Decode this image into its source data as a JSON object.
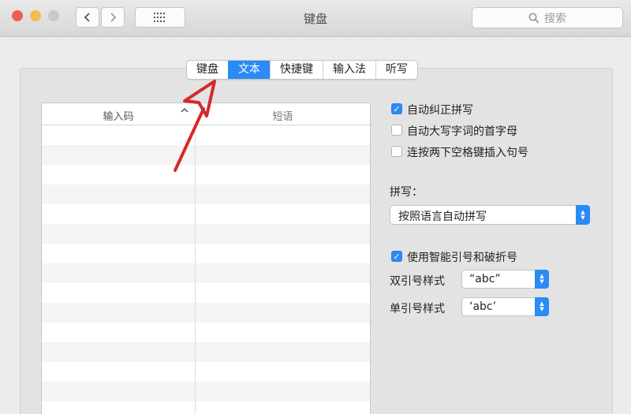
{
  "window": {
    "title": "键盘",
    "search_placeholder": "搜索",
    "traffic_lights": {
      "close": "#ee5d57",
      "minimize": "#f5bd4f",
      "zoom": "#c9c9c9"
    }
  },
  "toolbar": {
    "back_icon": "chevron-left-icon",
    "forward_icon": "chevron-right-icon",
    "grid_icon": "grid-icon",
    "search_icon": "magnifier-icon"
  },
  "tabs": [
    {
      "label": "键盘",
      "selected": false
    },
    {
      "label": "文本",
      "selected": true
    },
    {
      "label": "快捷键",
      "selected": false
    },
    {
      "label": "输入法",
      "selected": false
    },
    {
      "label": "听写",
      "selected": false
    }
  ],
  "table": {
    "col1_header": "输入码",
    "col2_header": "短语",
    "sort_icon": "sort-ascending-icon"
  },
  "options": {
    "autocorrect": {
      "label": "自动纠正拼写",
      "checked": true
    },
    "capitalize": {
      "label": "自动大写字词的首字母",
      "checked": false
    },
    "double_space_period": {
      "label": "连按两下空格键插入句号",
      "checked": false
    },
    "spelling_label": "拼写：",
    "spelling_value": "按照语言自动拼写",
    "smart_quotes": {
      "label": "使用智能引号和破折号",
      "checked": true
    },
    "double_quote_label": "双引号样式",
    "double_quote_value": "“abc”",
    "single_quote_label": "单引号样式",
    "single_quote_value": "‘abc’"
  },
  "colors": {
    "accent": "#2a8bf7",
    "annotation_arrow": "#d42a2a"
  }
}
